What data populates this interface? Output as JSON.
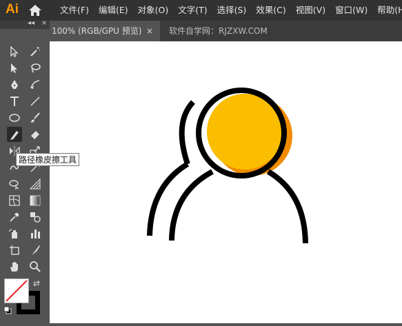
{
  "app": {
    "logo": "Ai"
  },
  "menubar": {
    "items": [
      "文件(F)",
      "编辑(E)",
      "对象(O)",
      "文字(T)",
      "选择(S)",
      "效果(C)",
      "视图(V)",
      "窗口(W)",
      "帮助(H)"
    ]
  },
  "toolbar": {
    "collapse_glyph": "◂◂",
    "close_glyph": "×",
    "tools": [
      "selection-tool",
      "magic-wand-tool",
      "direct-selection-tool",
      "lasso-tool",
      "pen-tool",
      "curvature-tool",
      "type-tool",
      "line-segment-tool",
      "ellipse-tool",
      "paintbrush-tool",
      "path-eraser-tool",
      "eraser-tool",
      "reflect-tool",
      "scale-tool",
      "warp-tool",
      "free-transform-tool",
      "shape-builder-tool",
      "perspective-grid-tool",
      "mesh-tool",
      "gradient-tool",
      "eyedropper-tool",
      "blend-tool",
      "symbol-sprayer-tool",
      "column-graph-tool",
      "artboard-tool",
      "slice-tool",
      "hand-tool",
      "zoom-tool"
    ]
  },
  "tooltip": {
    "text": "路径橡皮擦工具"
  },
  "tabs": {
    "active_label": "100% (RGB/GPU 预览)",
    "close_glyph": "×",
    "second_label": "软件自学网：RJZXW.COM"
  },
  "colors": {
    "fill": "#ffffff",
    "stroke": "#000000",
    "accent": "#fbbd00",
    "shadow": "#f08c00"
  },
  "swap_glyph": "⇄"
}
